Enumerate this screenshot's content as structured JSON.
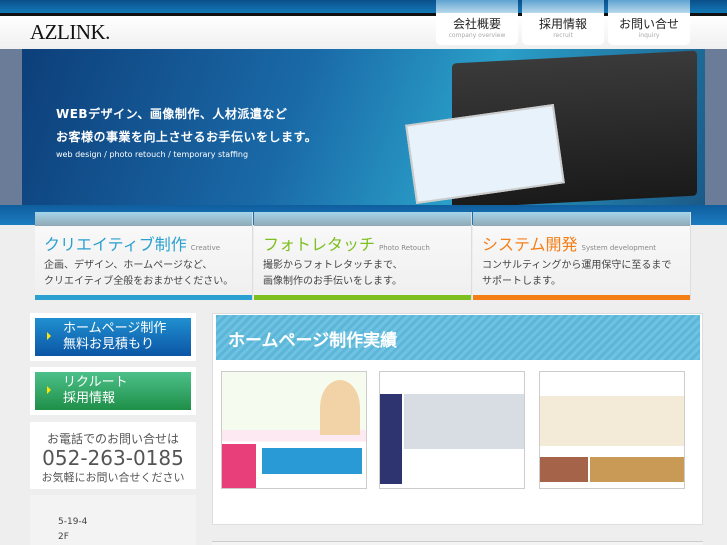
{
  "header": {
    "logo": "AZLINK.",
    "nav": [
      {
        "jp": "会社概要",
        "en": "company overview"
      },
      {
        "jp": "採用情報",
        "en": "recruit"
      },
      {
        "jp": "お問い合せ",
        "en": "inquiry"
      }
    ]
  },
  "hero": {
    "line1": "WEBデザイン、画像制作、人材派遣など",
    "line2": "お客様の事業を向上させるお手伝いをします。",
    "line3": "web design / photo retouch / temporary staffing"
  },
  "services": [
    {
      "title": "クリエイティブ制作",
      "en": "Creative",
      "desc1": "企画、デザイン、ホームページなど、",
      "desc2": "クリエイティブ全般をおまかせください。",
      "color": "#2aa0d0"
    },
    {
      "title": "フォトレタッチ",
      "en": "Photo Retouch",
      "desc1": "撮影からフォトレタッチまで、",
      "desc2": "画像制作のお手伝いをします。",
      "color": "#7dbf1e"
    },
    {
      "title": "システム開発",
      "en": "System development",
      "desc1": "コンサルティングから運用保守に至るまで",
      "desc2": "サポートします。",
      "color": "#f57f17"
    }
  ],
  "sidebar": {
    "estimate": {
      "line1": "ホームページ制作",
      "line2": "無料お見積もり"
    },
    "recruit": {
      "line1": "リクルート",
      "line2": "採用情報"
    },
    "tel": {
      "label": "お電話でのお問い合せは",
      "number": "052-263-0185",
      "note": "お気軽にお問い合せください"
    },
    "address": {
      "line1": "5-19-4",
      "line2": "2F"
    }
  },
  "main": {
    "title": "ホームページ制作実績"
  }
}
